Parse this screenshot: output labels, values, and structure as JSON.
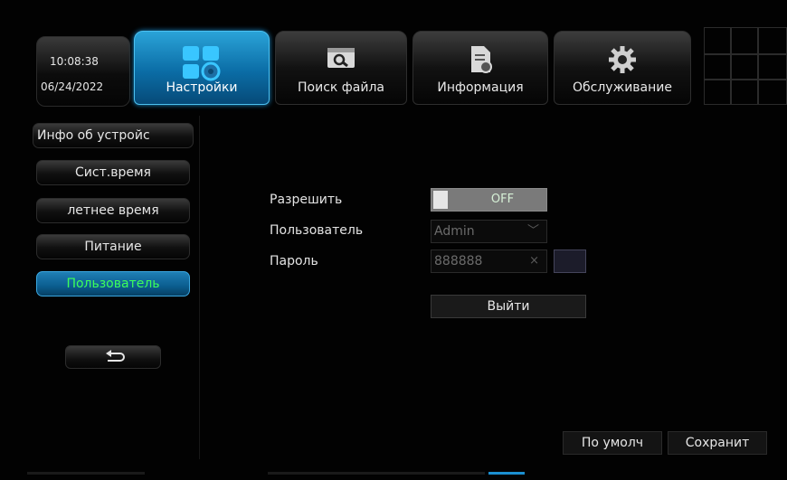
{
  "clock": {
    "time": "10:08:38",
    "date": "06/24/2022"
  },
  "tabs": [
    {
      "label": "Настройки",
      "icon": "settings-icon",
      "active": true
    },
    {
      "label": "Поиск файла",
      "icon": "search-file-icon",
      "active": false
    },
    {
      "label": "Информация",
      "icon": "information-icon",
      "active": false
    },
    {
      "label": "Обслуживание",
      "icon": "maintenance-gear-icon",
      "active": false
    }
  ],
  "sidebar": {
    "items": [
      {
        "label": "Инфо об устройс"
      },
      {
        "label": "Сист.время"
      },
      {
        "label": "летнее время"
      },
      {
        "label": "Питание"
      },
      {
        "label": "Пользователь",
        "active": true
      }
    ],
    "back_icon": "back-arrow-icon"
  },
  "form": {
    "enable_label": "Разрешить",
    "enable_value": "OFF",
    "user_label": "Пользователь",
    "user_value": "Admin",
    "password_label": "Пароль",
    "password_value": "888888",
    "logout_label": "Выйти"
  },
  "footer": {
    "default_label": "По умолч",
    "save_label": "Сохранит"
  },
  "colors": {
    "accent": "#1b8fd0",
    "active_text": "#3dff5a"
  }
}
